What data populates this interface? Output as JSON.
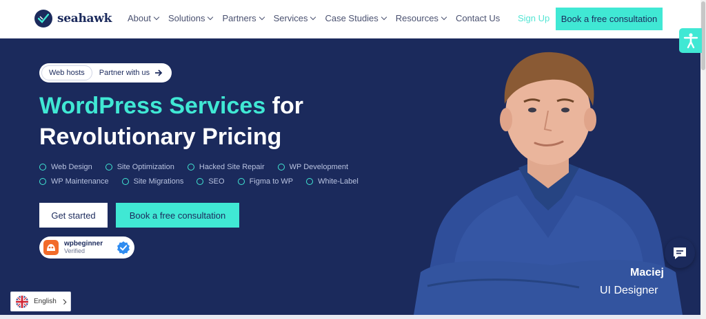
{
  "brand": {
    "name": "seahawk"
  },
  "nav": {
    "items": [
      {
        "label": "About"
      },
      {
        "label": "Solutions"
      },
      {
        "label": "Partners"
      },
      {
        "label": "Services"
      },
      {
        "label": "Case Studies"
      },
      {
        "label": "Resources"
      },
      {
        "label": "Contact Us"
      }
    ],
    "signup_label": "Sign Up",
    "cta_label": "Book a free consultation"
  },
  "hero": {
    "pills": {
      "active": "Web hosts",
      "link": "Partner with us"
    },
    "headline_accent": "WordPress Services",
    "headline_rest_1": " for",
    "headline_rest_2": "Revolutionary Pricing",
    "services": [
      "Web Design",
      "Site Optimization",
      "Hacked Site Repair",
      "WP Development",
      "WP Maintenance",
      "Site Migrations",
      "SEO",
      "Figma to WP",
      "White-Label"
    ],
    "primary_button": "Get started",
    "secondary_button": "Book a free consultation",
    "badge": {
      "name": "wpbeginner",
      "status": "Verified"
    },
    "person": {
      "name": "Maciej",
      "role": "UI Designer"
    }
  },
  "language": {
    "label": "English"
  },
  "colors": {
    "navy": "#1b2a5c",
    "accent": "#40e8d4",
    "white": "#ffffff"
  },
  "icons": [
    "logo-check-icon",
    "chevron-down-icon",
    "arrow-right-icon",
    "wpbeginner-logo-icon",
    "verified-check-icon",
    "accessibility-icon",
    "chat-icon",
    "uk-flag-icon",
    "chevron-right-icon"
  ]
}
